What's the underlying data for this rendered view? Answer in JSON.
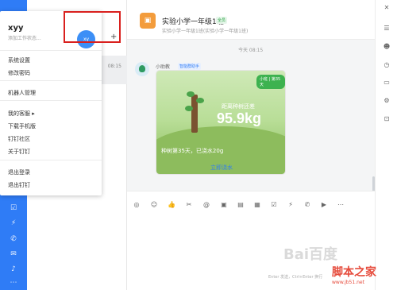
{
  "window": {
    "close_glyph": "✕"
  },
  "menu": {
    "user_name": "xyy",
    "status_placeholder": "添加工作状态...",
    "avatar_text": "xy",
    "add_glyph": "+",
    "items": [
      {
        "label": "系统设置"
      },
      {
        "label": "修改密码"
      },
      {
        "label": "机器人管理"
      },
      {
        "label": "我的客服"
      },
      {
        "label": "下载手机版"
      },
      {
        "label": "钉钉社区"
      },
      {
        "label": "关于钉钉"
      },
      {
        "label": "退出登录"
      },
      {
        "label": "退出钉钉"
      }
    ]
  },
  "conversation_list": {
    "time": "08:15"
  },
  "chat": {
    "title": "实验小学一年级1班",
    "title_tag": "全员",
    "subtitle": "实验小学一年级1班(实验小学一年级1班)",
    "timestamp": "今天 08:15",
    "bot_name": "小助教",
    "bot_tag": "智能群助手",
    "card": {
      "badge": "小班 | 第35天",
      "distance_label": "距离种树还差",
      "distance_value": "95.9kg",
      "days_text": "种树第35天，已浇水20g",
      "action": "立即浇水"
    },
    "input_hint": "Enter 发送，Ctrl+Enter 换行"
  },
  "watermark": {
    "baidu": "Bai百度",
    "site_name": "脚本之家",
    "site_url": "www.jb51.net"
  },
  "icons": {
    "left_rail": [
      "check-icon",
      "flash-icon",
      "phone-icon",
      "mail-icon",
      "bell-icon",
      "more-icon"
    ],
    "toolbar": [
      "gif-icon",
      "emoji-icon",
      "like-icon",
      "scissors-icon",
      "at-icon",
      "image-icon",
      "file-icon",
      "calendar-icon",
      "check-icon",
      "flash-icon",
      "phone-icon",
      "video-icon",
      "more-icon"
    ],
    "right_rail": [
      "chat-icon",
      "member-icon",
      "history-icon",
      "folder-icon",
      "settings-icon",
      "robot-icon"
    ]
  }
}
